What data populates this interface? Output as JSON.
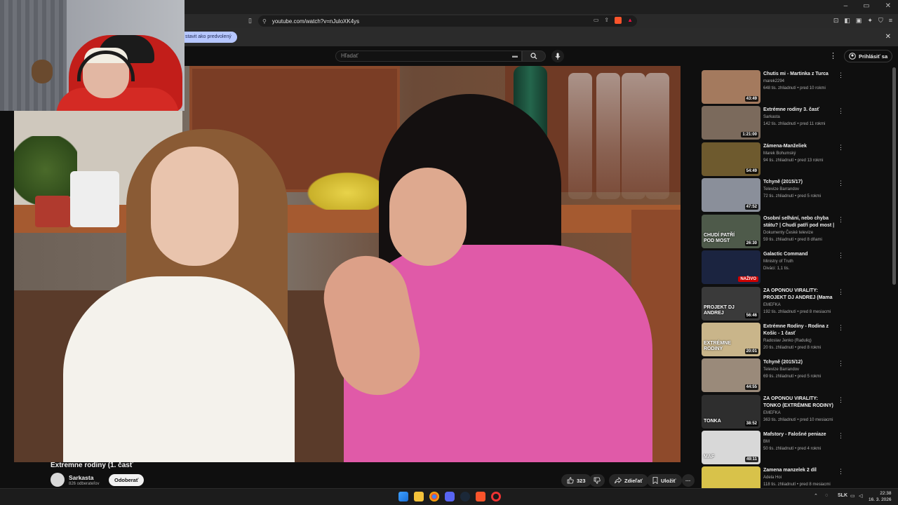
{
  "browser": {
    "url": "youtube.com/watch?v=nJuloXK4ys",
    "set_default_label": "stavit ako predvolený",
    "infobar_close": "✕",
    "window_controls": [
      "–",
      "▭",
      "✕"
    ]
  },
  "masthead": {
    "search_placeholder": "Hľadať",
    "signin_label": "Prihlásiť sa",
    "more": "⋮"
  },
  "video": {
    "title": "Extremne rodiny (1. časť",
    "channel": "Sarkasta",
    "subscribers": "826 odberateľov",
    "subscribe_label": "Odoberať",
    "like_count": "323",
    "share_label": "Zdieľať",
    "save_label": "Uložiť",
    "more": "···"
  },
  "recommendations": [
    {
      "title": "Chutis mi - Martinka z Turca",
      "channel": "marek2294",
      "meta": "648 tis. zhliadnutí • pred 10 rokmi",
      "duration": "43:49",
      "thumb": "#a47a5e"
    },
    {
      "title": "Extrémne rodiny 3. časť",
      "channel": "Sarkasta",
      "meta": "142 tis. zhliadnutí • pred 11 rokmi",
      "duration": "1:21:00",
      "thumb": "#7b6a5c"
    },
    {
      "title": "Zámena-Manželiek",
      "channel": "Marek Bohumský",
      "meta": "94 tis. zhliadnutí • pred 13 rokmi",
      "duration": "54:49",
      "thumb": "#6e5a2e"
    },
    {
      "title": "Tchyně (2015/17)",
      "channel": "Televize Barrandov",
      "meta": "72 tis. zhliadnutí • pred 5 rokmi",
      "duration": "47:52",
      "thumb": "#8a8f9a"
    },
    {
      "title": "Osobní selhání, nebo chyba státu? | Chudí patří pod most | ...",
      "channel": "Dokumenty České televize",
      "meta": "59 tis. zhliadnutí • pred 8 dňami",
      "duration": "26:30",
      "thumb": "#4e5a4a",
      "thumb_text": "CHUDÍ PATŘÍ POD MOST"
    },
    {
      "title": "Galactic Command",
      "channel": "Ministry of Truth",
      "meta": "Diváci: 1,1 tis.",
      "live": "NAŽIVO",
      "thumb": "#1b2440"
    },
    {
      "title": "ZA OPONOU VIRALITY: PROJEKT DJ ANDREJ (Mama ...",
      "channel": "EMEFKA",
      "meta": "192 tis. zhliadnutí • pred 8 mesiacmi",
      "duration": "56:46",
      "thumb": "#3a3a3a",
      "thumb_text": "PROJEKT DJ ANDREJ"
    },
    {
      "title": "Extrémne Rodiny - Rodina z Košíc - 1 časť",
      "channel": "Radoslav Jenko (Raduliq)",
      "meta": "20 tis. zhliadnutí • pred 8 rokmi",
      "duration": "20:01",
      "thumb": "#c9b58a",
      "thumb_text": "EXTRÉMNE RODINY"
    },
    {
      "title": "Tchyně (2015/12)",
      "channel": "Televize Barrandov",
      "meta": "69 tis. zhliadnutí • pred 5 rokmi",
      "duration": "44:55",
      "thumb": "#9a8a7a"
    },
    {
      "title": "ZA OPONOU VIRALITY: TONKO (EXTRÉMNE RODINY)",
      "channel": "EMEFKA",
      "meta": "363 tis. zhliadnutí • pred 10 mesiacmi",
      "duration": "38:52",
      "thumb": "#2e2e2e",
      "thumb_text": "TONKA"
    },
    {
      "title": "Mafstory - Falošné peniaze",
      "channel": "BM",
      "meta": "50 tis. zhliadnutí • pred 4 rokmi",
      "duration": "49:11",
      "thumb": "#d8d8d8",
      "thumb_text": "MAF"
    },
    {
      "title": "Zamena manzelek 2 díl",
      "channel": "Adela Hoi",
      "meta": "118 tis. zhliadnutí • pred 8 mesiacmi",
      "duration": "",
      "thumb": "#d8c24a"
    }
  ],
  "taskbar": {
    "language": "SLK",
    "time": "22:38",
    "date": "16. 3. 2026"
  },
  "colors": {
    "youtube_bg": "#0f0f0f",
    "live_red": "#cc0000",
    "brave_orange": "#fb542b",
    "infobar_pill": "#b6c7ff"
  }
}
